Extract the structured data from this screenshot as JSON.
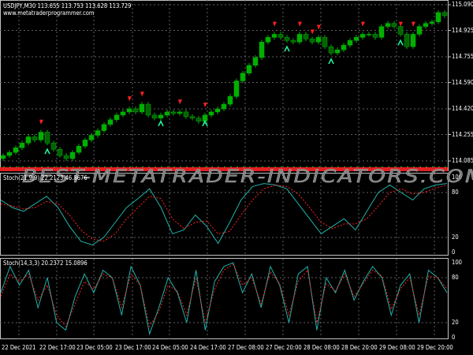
{
  "header": {
    "symbol_line": "USDJPY,M30  113.655 113.753 113.628 113.729",
    "website": "www.metatraderprogrammer.com"
  },
  "watermark": "BEST-METATRADER-INDICATORS.COM",
  "colors": {
    "bull": "#00b000",
    "bear": "#006400",
    "main_line": "#20b2aa",
    "signal_line": "#ff2020",
    "grid": "#606060",
    "axis": "#c0c0c0",
    "arrow_down": "#ff2020",
    "arrow_up": "#20ffa0"
  },
  "chart_data": [
    {
      "type": "candlestick",
      "title": "USDJPY,M30",
      "ylim": [
        114.085,
        115.09
      ],
      "y_ticks": [
        "115.090",
        "114.925",
        "114.755",
        "114.590",
        "114.420",
        "114.255",
        "114.085"
      ],
      "x_ticks": [
        "22 Dec 2021",
        "22 Dec 17:00",
        "23 Dec 05:00",
        "23 Dec 17:00",
        "24 Dec 05:00",
        "24 Dec 17:00",
        "27 Dec 08:00",
        "27 Dec 20:00",
        "28 Dec 08:00",
        "28 Dec 20:00",
        "29 Dec 08:00",
        "29 Dec 20:00"
      ],
      "close": [
        114.12,
        114.14,
        114.17,
        114.2,
        114.24,
        114.22,
        114.27,
        114.2,
        114.16,
        114.12,
        114.1,
        114.14,
        114.18,
        114.22,
        114.25,
        114.28,
        114.32,
        114.35,
        114.38,
        114.4,
        114.42,
        114.4,
        114.45,
        114.38,
        114.36,
        114.38,
        114.4,
        114.39,
        114.4,
        114.37,
        114.36,
        114.34,
        114.38,
        114.4,
        114.42,
        114.45,
        114.5,
        114.6,
        114.65,
        114.7,
        114.75,
        114.85,
        114.88,
        114.9,
        114.88,
        114.86,
        114.85,
        114.9,
        114.87,
        114.85,
        114.88,
        114.82,
        114.78,
        114.8,
        114.83,
        114.86,
        114.88,
        114.9,
        114.9,
        114.88,
        114.95,
        114.97,
        114.95,
        114.9,
        114.82,
        114.9,
        114.95,
        114.97,
        114.98,
        115.04,
        115.02
      ],
      "sell_arrows": [
        6,
        20,
        22,
        28,
        32,
        43,
        47,
        49,
        50,
        57,
        63,
        65
      ],
      "buy_arrows": [
        7,
        25,
        32,
        45,
        52,
        63
      ]
    },
    {
      "type": "line",
      "title": "Stoch(21,9,9) 22.2123 46.8676",
      "ylim": [
        0,
        100
      ],
      "y_ticks": [
        "100",
        "80",
        "20",
        "0"
      ],
      "series": [
        {
          "name": "main",
          "values": [
            70,
            60,
            55,
            65,
            75,
            60,
            35,
            15,
            10,
            20,
            40,
            60,
            72,
            85,
            60,
            25,
            30,
            50,
            35,
            12,
            40,
            70,
            88,
            92,
            90,
            85,
            65,
            45,
            25,
            35,
            45,
            30,
            55,
            80,
            90,
            80,
            70,
            85,
            90,
            92
          ]
        },
        {
          "name": "signal",
          "values": [
            65,
            62,
            58,
            60,
            68,
            65,
            50,
            30,
            18,
            15,
            25,
            45,
            60,
            75,
            72,
            45,
            32,
            40,
            42,
            25,
            28,
            50,
            70,
            85,
            90,
            88,
            78,
            60,
            40,
            32,
            38,
            38,
            45,
            62,
            80,
            85,
            78,
            80,
            86,
            90
          ]
        }
      ]
    },
    {
      "type": "line",
      "title": "Stoch(14,3,3) 20.2372 15.0896",
      "ylim": [
        0,
        100
      ],
      "y_ticks": [
        "100",
        "80",
        "20",
        "0"
      ],
      "series": [
        {
          "name": "main",
          "values": [
            60,
            95,
            70,
            90,
            40,
            80,
            20,
            10,
            55,
            85,
            60,
            90,
            80,
            30,
            95,
            70,
            5,
            40,
            80,
            60,
            20,
            90,
            10,
            75,
            95,
            100,
            60,
            85,
            40,
            95,
            70,
            20,
            85,
            95,
            10,
            80,
            60,
            90,
            50,
            75,
            95,
            80,
            30,
            70,
            85,
            20,
            90,
            80,
            60
          ]
        },
        {
          "name": "signal",
          "values": [
            55,
            85,
            75,
            85,
            50,
            70,
            30,
            15,
            45,
            75,
            65,
            85,
            80,
            40,
            85,
            70,
            15,
            35,
            70,
            62,
            30,
            80,
            20,
            65,
            90,
            98,
            70,
            80,
            45,
            88,
            72,
            30,
            75,
            90,
            20,
            72,
            62,
            85,
            55,
            72,
            90,
            82,
            38,
            65,
            80,
            30,
            82,
            80,
            65
          ]
        }
      ]
    }
  ]
}
